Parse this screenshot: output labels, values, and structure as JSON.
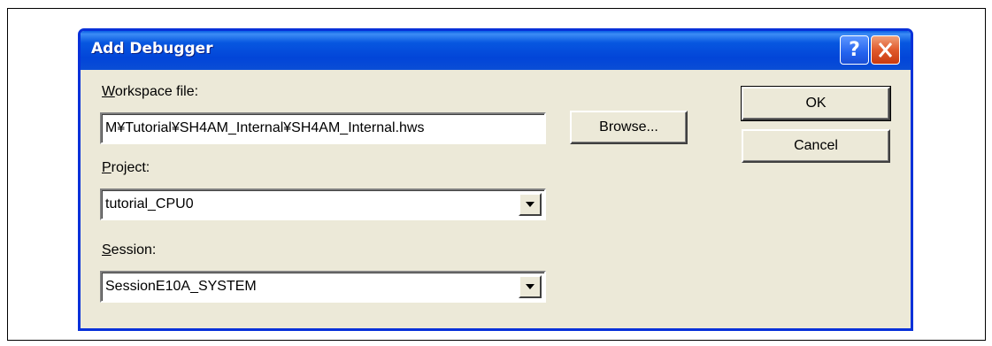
{
  "window": {
    "title": "Add Debugger",
    "help_glyph": "?",
    "close_icon": "close-icon"
  },
  "workspace": {
    "label": "Workspace file:",
    "value": "M¥Tutorial¥SH4AM_Internal¥SH4AM_Internal.hws",
    "browse_label": "Browse..."
  },
  "project": {
    "label": "Project:",
    "value": "tutorial_CPU0"
  },
  "session": {
    "label": "Session:",
    "value": "SessionE10A_SYSTEM"
  },
  "buttons": {
    "ok_label": "OK",
    "cancel_label": "Cancel"
  },
  "colors": {
    "titlebar": "#0245d8",
    "dialog_bg": "#ece9d8",
    "close_button": "#e05a2c"
  }
}
